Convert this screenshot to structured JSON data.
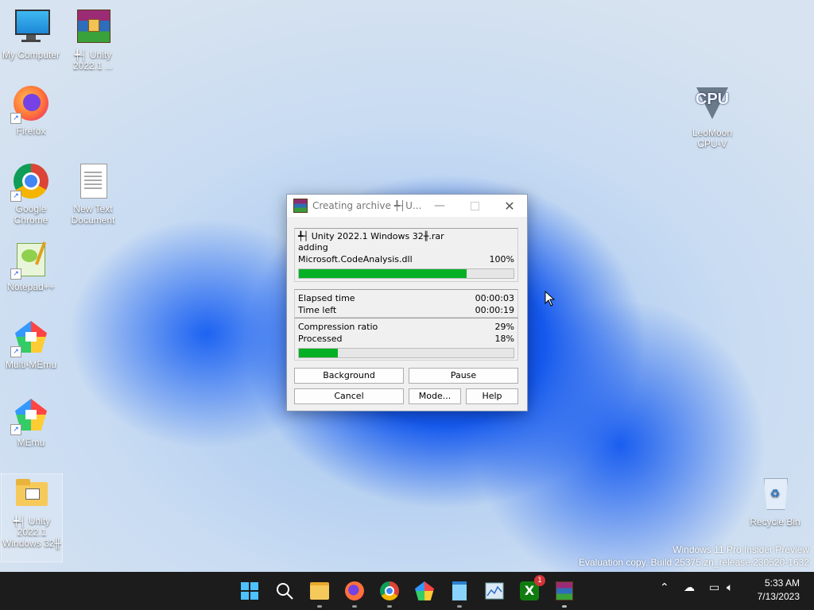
{
  "desktop": {
    "icons": [
      {
        "label": "My Computer"
      },
      {
        "label": "╇┤ Unity 2022.1 ..."
      },
      {
        "label": "Firefox"
      },
      {
        "label": "Google Chrome"
      },
      {
        "label": "New Text Document"
      },
      {
        "label": "Notepad++"
      },
      {
        "label": "Multi-MEmu"
      },
      {
        "label": "MEmu"
      },
      {
        "label": "╇┤ Unity 2022.1 Windows 32╫"
      },
      {
        "label": "LeoMoon CPU-V"
      },
      {
        "label": "Recycle Bin"
      }
    ],
    "cpu_logo_text": "CPU"
  },
  "dialog": {
    "title": "Creating archive ╇┤U...",
    "archive_name": "╇┤ Unity 2022.1 Windows 32╫.rar",
    "action": "adding",
    "current_file": "Microsoft.CodeAnalysis.dll",
    "file_progress_text": "100%",
    "file_progress_fill": 0.78,
    "elapsed_label": "Elapsed time",
    "elapsed_value": "00:00:03",
    "left_label": "Time left",
    "left_value": "00:00:19",
    "ratio_label": "Compression ratio",
    "ratio_value": "29%",
    "processed_label": "Processed",
    "processed_value": "18%",
    "processed_fill": 0.18,
    "buttons": {
      "background": "Background",
      "pause": "Pause",
      "cancel": "Cancel",
      "mode": "Mode...",
      "help": "Help"
    }
  },
  "watermark": {
    "line1": "Windows 11 Pro Insider Preview",
    "line2": "Evaluation copy. Build 25375.zn_release.230520-1632"
  },
  "taskbar": {
    "badge_count": "1",
    "clock_time": "5:33 AM",
    "clock_date": "7/13/2023"
  },
  "colors": {
    "progress": "#06b025",
    "taskbar": "#1c1c1c"
  }
}
